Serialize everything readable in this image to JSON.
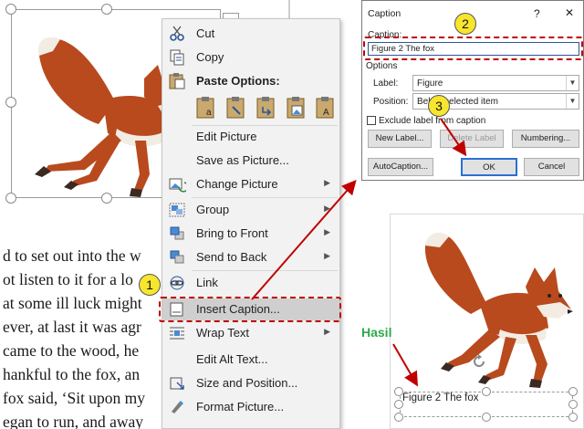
{
  "document": {
    "lines": [
      "d to set out into the w",
      "ot listen to it for a lo",
      "at some ill luck might",
      "ever, at last it was agr",
      "came to the wood, he",
      "hankful to the fox, an",
      "fox said, ‘Sit upon my",
      "egan to run, and away"
    ]
  },
  "context_menu": {
    "items": [
      {
        "icon": "scissors-icon",
        "label": "Cut"
      },
      {
        "icon": "copy-icon",
        "label": "Copy"
      },
      {
        "icon": "paste-icon",
        "label": "Paste Options:"
      },
      {
        "icon": "",
        "label": "Edit Picture"
      },
      {
        "icon": "",
        "label": "Save as Picture..."
      },
      {
        "icon": "change-picture-icon",
        "label": "Change Picture"
      },
      {
        "icon": "group-icon",
        "label": "Group"
      },
      {
        "icon": "bring-to-front-icon",
        "label": "Bring to Front"
      },
      {
        "icon": "send-to-back-icon",
        "label": "Send to Back"
      },
      {
        "icon": "link-icon",
        "label": "Link"
      },
      {
        "icon": "insert-caption-icon",
        "label": "Insert Caption..."
      },
      {
        "icon": "wrap-text-icon",
        "label": "Wrap Text"
      },
      {
        "icon": "",
        "label": "Edit Alt Text..."
      },
      {
        "icon": "size-position-icon",
        "label": "Size and Position..."
      },
      {
        "icon": "format-picture-icon",
        "label": "Format Picture..."
      }
    ]
  },
  "caption_dialog": {
    "title": "Caption",
    "help": "?",
    "close": "✕",
    "caption_label": "Caption:",
    "caption_value": "Figure 2 The fox",
    "options_label": "Options",
    "label_label": "Label:",
    "label_value": "Figure",
    "position_label": "Position:",
    "position_value": "Below selected item",
    "exclude_label": "Exclude label from caption",
    "new_label_button": "New Label...",
    "delete_label_button": "Delete Label",
    "numbering_button": "Numbering...",
    "autocaption_button": "AutoCaption...",
    "ok_button": "OK",
    "cancel_button": "Cancel"
  },
  "result": {
    "annotation": "Hasil",
    "caption_text": "Figure 2 The fox"
  },
  "badges": [
    "1",
    "2",
    "3"
  ],
  "colors": {
    "annotation_red": "#c00000",
    "badge_yellow": "#f7e52e",
    "hasil_green": "#2eaa4a",
    "fox_orange": "#b84a1e"
  }
}
